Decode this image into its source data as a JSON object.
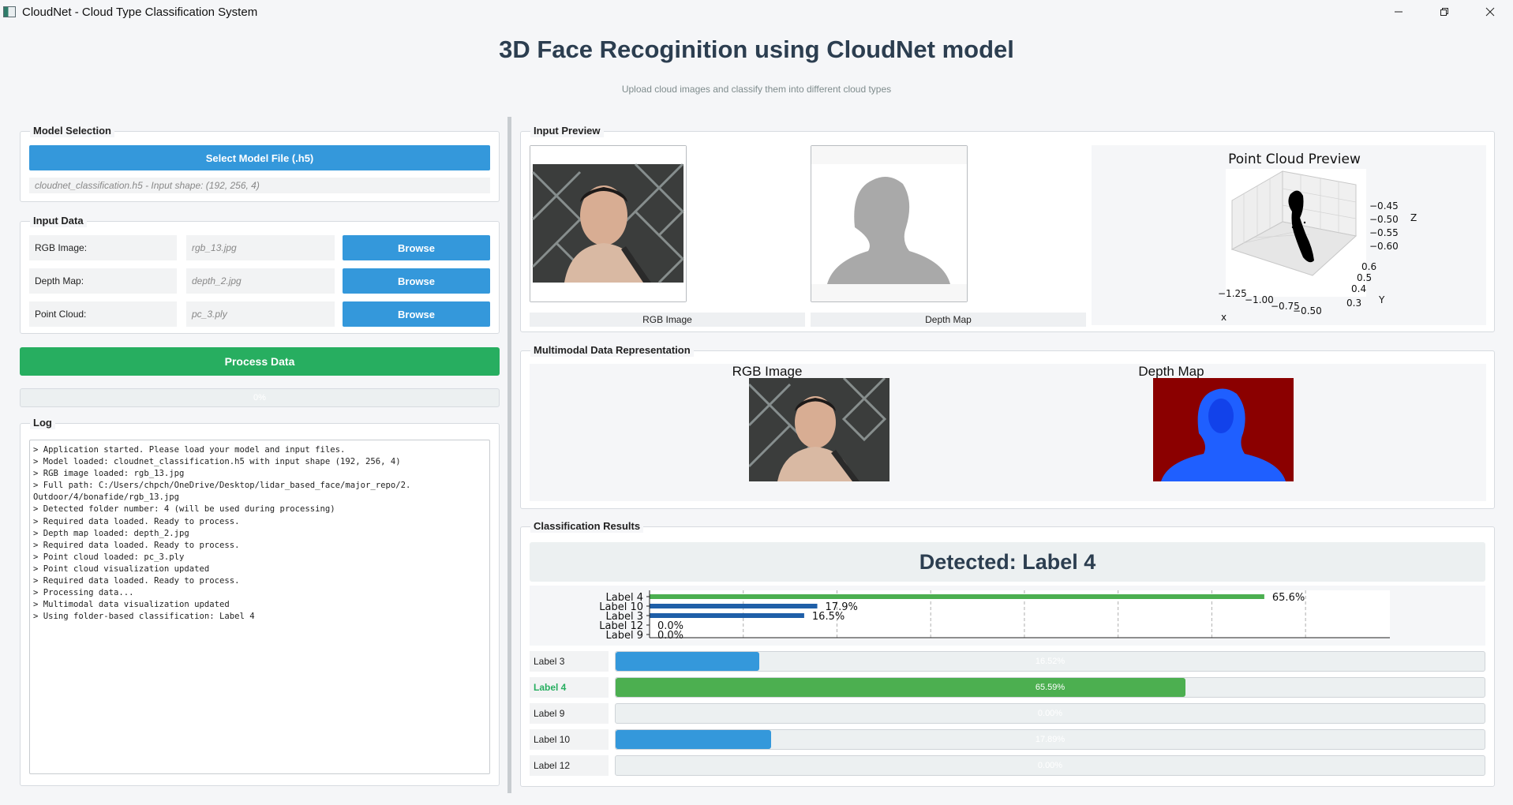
{
  "window": {
    "title": "CloudNet - Cloud Type Classification System",
    "controls": [
      "minimize-icon",
      "restore-icon",
      "close-icon"
    ]
  },
  "header": {
    "title": "3D Face Recoginition using CloudNet model",
    "subtitle": "Upload cloud images and classify them into different cloud types"
  },
  "model": {
    "group_title": "Model Selection",
    "select_button": "Select Model File (.h5)",
    "status": "cloudnet_classification.h5 - Input shape: (192, 256, 4)"
  },
  "input_data": {
    "group_title": "Input Data",
    "rows": [
      {
        "label": "RGB Image:",
        "value": "rgb_13.jpg",
        "button": "Browse"
      },
      {
        "label": "Depth Map:",
        "value": "depth_2.jpg",
        "button": "Browse"
      },
      {
        "label": "Point Cloud:",
        "value": "pc_3.ply",
        "button": "Browse"
      }
    ]
  },
  "process": {
    "button": "Process Data",
    "progress_text": "0%",
    "progress_value": 0
  },
  "log": {
    "group_title": "Log",
    "text": "> Application started. Please load your model and input files.\n> Model loaded: cloudnet_classification.h5 with input shape (192, 256, 4)\n> RGB image loaded: rgb_13.jpg\n> Full path: C:/Users/chpch/OneDrive/Desktop/lidar_based_face/major_repo/2.\nOutdoor/4/bonafide/rgb_13.jpg\n> Detected folder number: 4 (will be used during processing)\n> Required data loaded. Ready to process.\n> Depth map loaded: depth_2.jpg\n> Required data loaded. Ready to process.\n> Point cloud loaded: pc_3.ply\n> Point cloud visualization updated\n> Required data loaded. Ready to process.\n> Processing data...\n> Multimodal data visualization updated\n> Using folder-based classification: Label 4"
  },
  "preview": {
    "group_title": "Input Preview",
    "rgb_caption": "RGB Image",
    "depth_caption": "Depth Map",
    "pc_title": "Point Cloud Preview",
    "pc_axes": {
      "x_label": "x",
      "x_ticks": [
        "−1.25",
        "−1.00",
        "−0.75",
        "−0.50"
      ],
      "y_label": "Y",
      "y_ticks": [
        "0.6",
        "0.5",
        "0.4",
        "0.3"
      ],
      "z_label": "Z",
      "z_ticks": [
        "−0.45",
        "−0.50",
        "−0.55",
        "−0.60"
      ]
    }
  },
  "multimodal": {
    "group_title": "Multimodal Data Representation",
    "rgb_title": "RGB Image",
    "depth_title": "Depth Map"
  },
  "results": {
    "group_title": "Classification Results",
    "detected": "Detected: Label 4",
    "rows": [
      {
        "label": "Label 3",
        "value": 16.52,
        "text": "16.52%",
        "color": "#3498db",
        "highlight": false
      },
      {
        "label": "Label 4",
        "value": 65.59,
        "text": "65.59%",
        "color": "#4caf50",
        "highlight": true
      },
      {
        "label": "Label 9",
        "value": 0.0,
        "text": "0.00%",
        "color": "#3498db",
        "highlight": false
      },
      {
        "label": "Label 10",
        "value": 17.89,
        "text": "17.89%",
        "color": "#3498db",
        "highlight": false
      },
      {
        "label": "Label 12",
        "value": 0.0,
        "text": "0.00%",
        "color": "#3498db",
        "highlight": false
      }
    ]
  },
  "chart_data": {
    "type": "bar",
    "orientation": "horizontal",
    "categories": [
      "Label 4",
      "Label 10",
      "Label 3",
      "Label 12",
      "Label 9"
    ],
    "values": [
      65.6,
      17.9,
      16.5,
      0.0,
      0.0
    ],
    "data_labels": [
      "65.6%",
      "17.9%",
      "16.5%",
      "0.0%",
      "0.0%"
    ],
    "colors": [
      "#4caf50",
      "#1f5fa8",
      "#1f5fa8",
      "#1f5fa8",
      "#1f5fa8"
    ],
    "xlim": [
      0,
      79
    ],
    "grid": true,
    "title": "",
    "xlabel": "",
    "ylabel": ""
  },
  "colors": {
    "accent_blue": "#3498db",
    "accent_green": "#27ae60",
    "heading": "#2c3e50"
  }
}
